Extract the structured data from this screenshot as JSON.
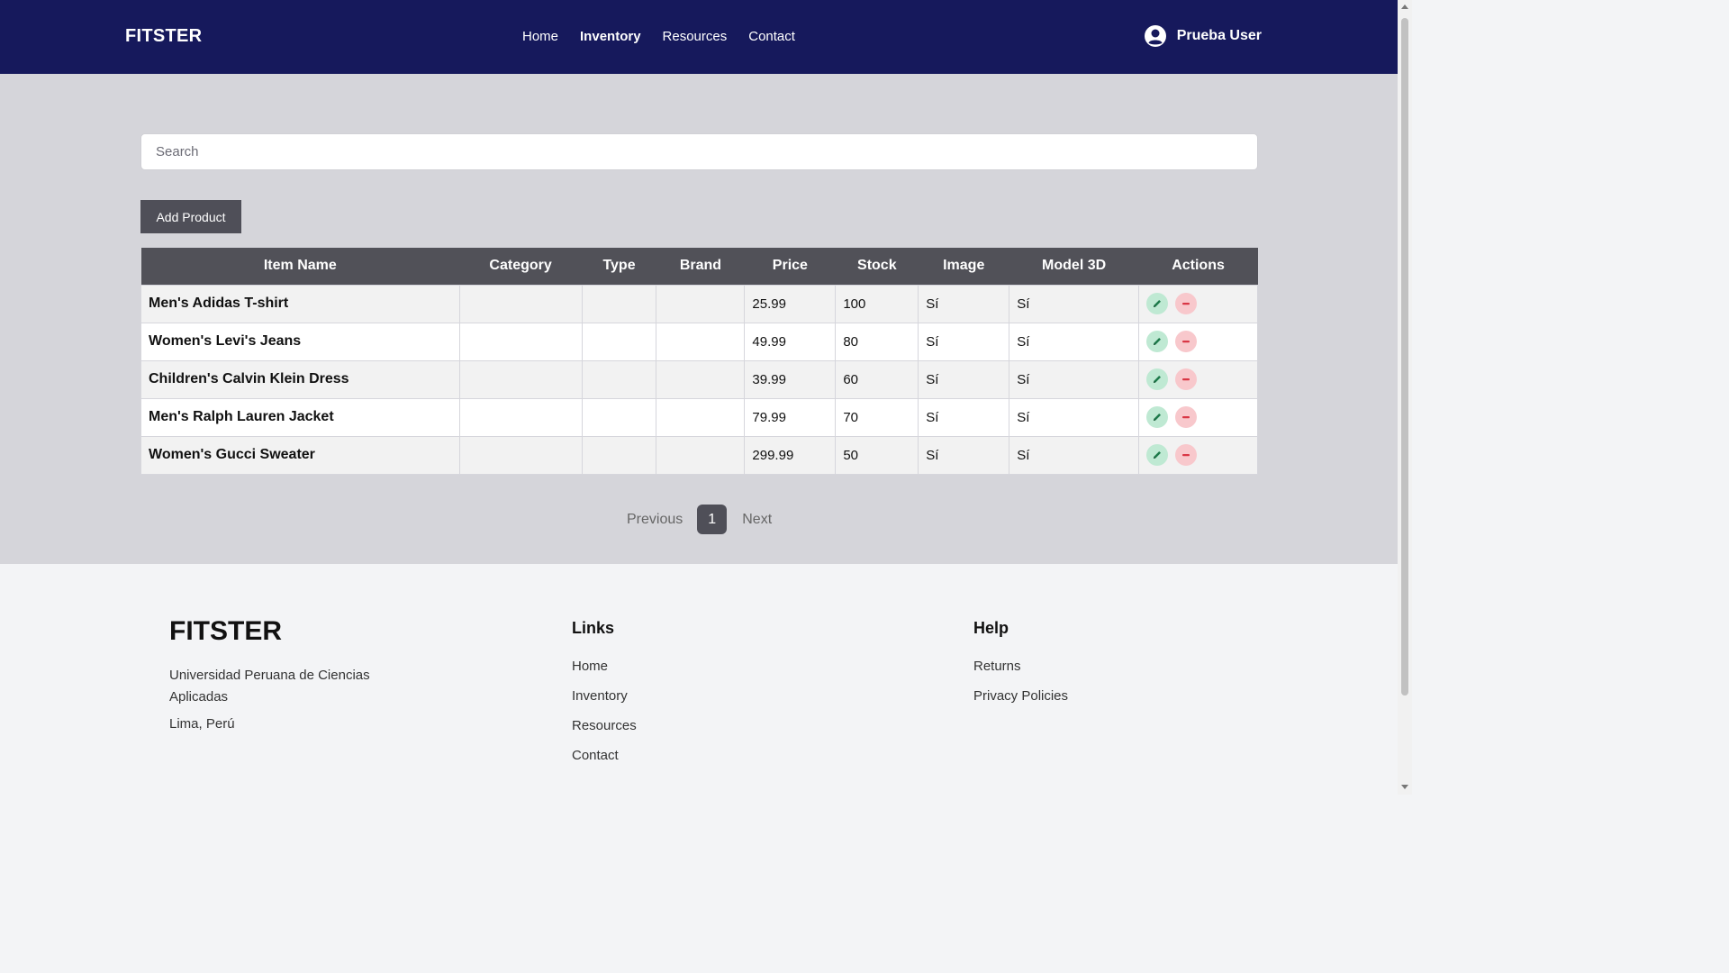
{
  "header": {
    "brand": "FITSTER",
    "nav": [
      {
        "label": "Home",
        "active": false
      },
      {
        "label": "Inventory",
        "active": true
      },
      {
        "label": "Resources",
        "active": false
      },
      {
        "label": "Contact",
        "active": false
      }
    ],
    "user_name": "Prueba User",
    "user_icon": "user-circle-icon"
  },
  "search": {
    "placeholder": "Search",
    "value": ""
  },
  "add_product_label": "Add Product",
  "table": {
    "columns": [
      "Item Name",
      "Category",
      "Type",
      "Brand",
      "Price",
      "Stock",
      "Image",
      "Model 3D",
      "Actions"
    ],
    "rows": [
      {
        "name": "Men's Adidas T-shirt",
        "category": "",
        "type": "",
        "brand": "",
        "price": "25.99",
        "stock": "100",
        "image": "Sí",
        "model3d": "Sí"
      },
      {
        "name": "Women's Levi's Jeans",
        "category": "",
        "type": "",
        "brand": "",
        "price": "49.99",
        "stock": "80",
        "image": "Sí",
        "model3d": "Sí"
      },
      {
        "name": "Children's Calvin Klein Dress",
        "category": "",
        "type": "",
        "brand": "",
        "price": "39.99",
        "stock": "60",
        "image": "Sí",
        "model3d": "Sí"
      },
      {
        "name": "Men's Ralph Lauren Jacket",
        "category": "",
        "type": "",
        "brand": "",
        "price": "79.99",
        "stock": "70",
        "image": "Sí",
        "model3d": "Sí"
      },
      {
        "name": "Women's Gucci Sweater",
        "category": "",
        "type": "",
        "brand": "",
        "price": "299.99",
        "stock": "50",
        "image": "Sí",
        "model3d": "Sí"
      }
    ],
    "action_icons": [
      "pencil-icon",
      "minus-icon"
    ]
  },
  "pagination": {
    "previous": "Previous",
    "current_page": "1",
    "next": "Next"
  },
  "footer": {
    "brand": "FITSTER",
    "address": "Universidad Peruana de Ciencias Aplicadas",
    "city": "Lima, Perú",
    "links_title": "Links",
    "links": [
      "Home",
      "Inventory",
      "Resources",
      "Contact"
    ],
    "help_title": "Help",
    "help_links": [
      "Returns",
      "Privacy Policies"
    ]
  },
  "colors": {
    "navbar": "#16195c",
    "main_bg": "#d5d5da",
    "table_header": "#515158",
    "edit_button": "#bfe9d3",
    "delete_button": "#f8c8cc"
  }
}
